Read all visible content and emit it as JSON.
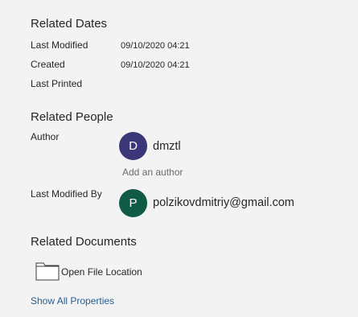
{
  "related_dates": {
    "title": "Related Dates",
    "last_modified_label": "Last Modified",
    "last_modified_value": "09/10/2020 04:21",
    "created_label": "Created",
    "created_value": "09/10/2020 04:21",
    "last_printed_label": "Last Printed"
  },
  "related_people": {
    "title": "Related People",
    "author_label": "Author",
    "author": {
      "initial": "D",
      "name": "dmztl",
      "color": "#3b3778"
    },
    "add_author": "Add an author",
    "last_modified_by_label": "Last Modified By",
    "last_modified_by": {
      "initial": "P",
      "name": "polzikovdmitriy@gmail.com",
      "color": "#0f5b45"
    }
  },
  "related_documents": {
    "title": "Related Documents",
    "open_file_location": "Open File Location",
    "folder_icon": "folder-icon"
  },
  "show_all_properties": "Show All Properties"
}
